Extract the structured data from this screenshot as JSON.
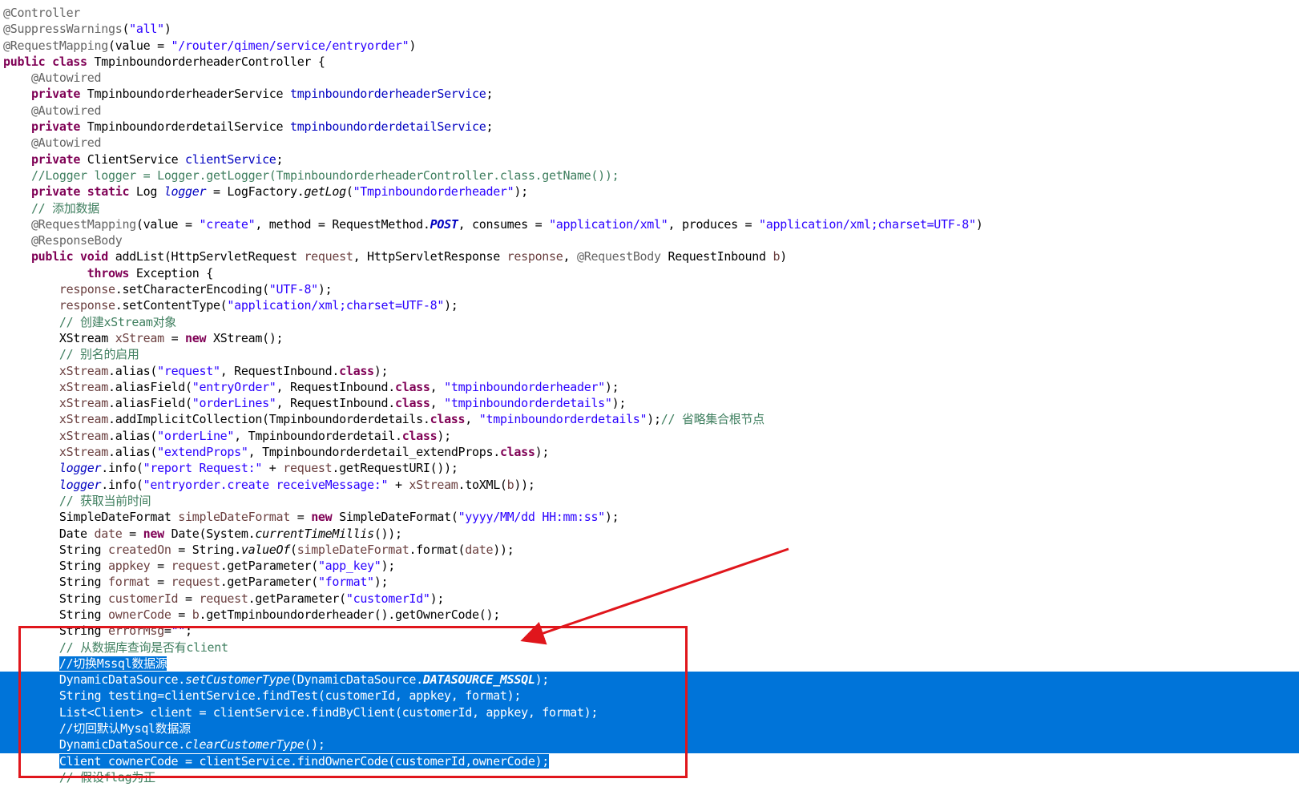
{
  "editor": {
    "lines": [
      {
        "indent": 0,
        "tokens": [
          {
            "t": "@Controller",
            "c": "ann"
          }
        ]
      },
      {
        "indent": 0,
        "tokens": [
          {
            "t": "@SuppressWarnings",
            "c": "ann"
          },
          {
            "t": "(",
            "c": "plain"
          },
          {
            "t": "\"all\"",
            "c": "str"
          },
          {
            "t": ")",
            "c": "plain"
          }
        ]
      },
      {
        "indent": 0,
        "tokens": [
          {
            "t": "@RequestMapping",
            "c": "ann"
          },
          {
            "t": "(value = ",
            "c": "plain"
          },
          {
            "t": "\"/router/qimen/service/entryorder\"",
            "c": "str"
          },
          {
            "t": ")",
            "c": "plain"
          }
        ]
      },
      {
        "indent": 0,
        "tokens": [
          {
            "t": "public class",
            "c": "kw"
          },
          {
            "t": " TmpinboundorderheaderController {",
            "c": "plain"
          }
        ]
      },
      {
        "indent": 1,
        "tokens": [
          {
            "t": "@Autowired",
            "c": "ann"
          }
        ]
      },
      {
        "indent": 1,
        "tokens": [
          {
            "t": "private",
            "c": "kw"
          },
          {
            "t": " TmpinboundorderheaderService ",
            "c": "plain"
          },
          {
            "t": "tmpinboundorderheaderService",
            "c": "fld"
          },
          {
            "t": ";",
            "c": "plain"
          }
        ]
      },
      {
        "indent": 1,
        "tokens": [
          {
            "t": "@Autowired",
            "c": "ann"
          }
        ]
      },
      {
        "indent": 1,
        "tokens": [
          {
            "t": "private",
            "c": "kw"
          },
          {
            "t": " TmpinboundorderdetailService ",
            "c": "plain"
          },
          {
            "t": "tmpinboundorderdetailService",
            "c": "fld"
          },
          {
            "t": ";",
            "c": "plain"
          }
        ]
      },
      {
        "indent": 1,
        "tokens": [
          {
            "t": "@Autowired",
            "c": "ann"
          }
        ]
      },
      {
        "indent": 1,
        "tokens": [
          {
            "t": "private",
            "c": "kw"
          },
          {
            "t": " ClientService ",
            "c": "plain"
          },
          {
            "t": "clientService",
            "c": "fld"
          },
          {
            "t": ";",
            "c": "plain"
          }
        ]
      },
      {
        "indent": 1,
        "tokens": [
          {
            "t": "//Logger logger = Logger.getLogger(TmpinboundorderheaderController.class.getName());",
            "c": "cm"
          }
        ]
      },
      {
        "indent": 1,
        "tokens": [
          {
            "t": "private static",
            "c": "kw"
          },
          {
            "t": " Log ",
            "c": "plain"
          },
          {
            "t": "logger",
            "c": "fld it"
          },
          {
            "t": " = LogFactory.",
            "c": "plain"
          },
          {
            "t": "getLog",
            "c": "plain it"
          },
          {
            "t": "(",
            "c": "plain"
          },
          {
            "t": "\"Tmpinboundorderheader\"",
            "c": "str"
          },
          {
            "t": ");",
            "c": "plain"
          }
        ]
      },
      {
        "indent": 1,
        "tokens": [
          {
            "t": "// 添加数据",
            "c": "cm"
          }
        ]
      },
      {
        "indent": 1,
        "tokens": [
          {
            "t": "@RequestMapping",
            "c": "ann"
          },
          {
            "t": "(value = ",
            "c": "plain"
          },
          {
            "t": "\"create\"",
            "c": "str"
          },
          {
            "t": ", method = RequestMethod.",
            "c": "plain"
          },
          {
            "t": "POST",
            "c": "fld it bld"
          },
          {
            "t": ", consumes = ",
            "c": "plain"
          },
          {
            "t": "\"application/xml\"",
            "c": "str"
          },
          {
            "t": ", produces = ",
            "c": "plain"
          },
          {
            "t": "\"application/xml;charset=UTF-8\"",
            "c": "str"
          },
          {
            "t": ")",
            "c": "plain"
          }
        ]
      },
      {
        "indent": 1,
        "tokens": [
          {
            "t": "@ResponseBody",
            "c": "ann"
          }
        ]
      },
      {
        "indent": 1,
        "tokens": [
          {
            "t": "public void",
            "c": "kw"
          },
          {
            "t": " addList(HttpServletRequest ",
            "c": "plain"
          },
          {
            "t": "request",
            "c": "var"
          },
          {
            "t": ", HttpServletResponse ",
            "c": "plain"
          },
          {
            "t": "response",
            "c": "var"
          },
          {
            "t": ", ",
            "c": "plain"
          },
          {
            "t": "@RequestBody",
            "c": "ann"
          },
          {
            "t": " RequestInbound ",
            "c": "plain"
          },
          {
            "t": "b",
            "c": "var"
          },
          {
            "t": ")",
            "c": "plain"
          }
        ]
      },
      {
        "indent": 3,
        "tokens": [
          {
            "t": "throws",
            "c": "kw"
          },
          {
            "t": " Exception {",
            "c": "plain"
          }
        ]
      },
      {
        "indent": 2,
        "tokens": [
          {
            "t": "response",
            "c": "var"
          },
          {
            "t": ".setCharacterEncoding(",
            "c": "plain"
          },
          {
            "t": "\"UTF-8\"",
            "c": "str"
          },
          {
            "t": ");",
            "c": "plain"
          }
        ]
      },
      {
        "indent": 2,
        "tokens": [
          {
            "t": "response",
            "c": "var"
          },
          {
            "t": ".setContentType(",
            "c": "plain"
          },
          {
            "t": "\"application/xml;charset=UTF-8\"",
            "c": "str"
          },
          {
            "t": ");",
            "c": "plain"
          }
        ]
      },
      {
        "indent": 2,
        "tokens": [
          {
            "t": "// 创建xStream对象",
            "c": "cm"
          }
        ]
      },
      {
        "indent": 2,
        "tokens": [
          {
            "t": "XStream ",
            "c": "plain"
          },
          {
            "t": "xStream",
            "c": "var"
          },
          {
            "t": " = ",
            "c": "plain"
          },
          {
            "t": "new",
            "c": "kw"
          },
          {
            "t": " XStream();",
            "c": "plain"
          }
        ]
      },
      {
        "indent": 2,
        "tokens": [
          {
            "t": "// 别名的启用",
            "c": "cm"
          }
        ]
      },
      {
        "indent": 2,
        "tokens": [
          {
            "t": "xStream",
            "c": "var"
          },
          {
            "t": ".alias(",
            "c": "plain"
          },
          {
            "t": "\"request\"",
            "c": "str"
          },
          {
            "t": ", RequestInbound.",
            "c": "plain"
          },
          {
            "t": "class",
            "c": "kw"
          },
          {
            "t": ");",
            "c": "plain"
          }
        ]
      },
      {
        "indent": 2,
        "tokens": [
          {
            "t": "xStream",
            "c": "var"
          },
          {
            "t": ".aliasField(",
            "c": "plain"
          },
          {
            "t": "\"entryOrder\"",
            "c": "str"
          },
          {
            "t": ", RequestInbound.",
            "c": "plain"
          },
          {
            "t": "class",
            "c": "kw"
          },
          {
            "t": ", ",
            "c": "plain"
          },
          {
            "t": "\"tmpinboundorderheader\"",
            "c": "str"
          },
          {
            "t": ");",
            "c": "plain"
          }
        ]
      },
      {
        "indent": 2,
        "tokens": [
          {
            "t": "xStream",
            "c": "var"
          },
          {
            "t": ".aliasField(",
            "c": "plain"
          },
          {
            "t": "\"orderLines\"",
            "c": "str"
          },
          {
            "t": ", RequestInbound.",
            "c": "plain"
          },
          {
            "t": "class",
            "c": "kw"
          },
          {
            "t": ", ",
            "c": "plain"
          },
          {
            "t": "\"tmpinboundorderdetails\"",
            "c": "str"
          },
          {
            "t": ");",
            "c": "plain"
          }
        ]
      },
      {
        "indent": 2,
        "tokens": [
          {
            "t": "xStream",
            "c": "var"
          },
          {
            "t": ".addImplicitCollection(Tmpinboundorderdetails.",
            "c": "plain"
          },
          {
            "t": "class",
            "c": "kw"
          },
          {
            "t": ", ",
            "c": "plain"
          },
          {
            "t": "\"tmpinboundorderdetails\"",
            "c": "str"
          },
          {
            "t": ");",
            "c": "plain"
          },
          {
            "t": "// 省略集合根节点",
            "c": "cm"
          }
        ]
      },
      {
        "indent": 2,
        "tokens": [
          {
            "t": "xStream",
            "c": "var"
          },
          {
            "t": ".alias(",
            "c": "plain"
          },
          {
            "t": "\"orderLine\"",
            "c": "str"
          },
          {
            "t": ", Tmpinboundorderdetail.",
            "c": "plain"
          },
          {
            "t": "class",
            "c": "kw"
          },
          {
            "t": ");",
            "c": "plain"
          }
        ]
      },
      {
        "indent": 2,
        "tokens": [
          {
            "t": "xStream",
            "c": "var"
          },
          {
            "t": ".alias(",
            "c": "plain"
          },
          {
            "t": "\"extendProps\"",
            "c": "str"
          },
          {
            "t": ", Tmpinboundorderdetail_extendProps.",
            "c": "plain"
          },
          {
            "t": "class",
            "c": "kw"
          },
          {
            "t": ");",
            "c": "plain"
          }
        ]
      },
      {
        "indent": 2,
        "tokens": [
          {
            "t": "logger",
            "c": "fld it"
          },
          {
            "t": ".info(",
            "c": "plain"
          },
          {
            "t": "\"report Request:\"",
            "c": "str"
          },
          {
            "t": " + ",
            "c": "plain"
          },
          {
            "t": "request",
            "c": "var"
          },
          {
            "t": ".getRequestURI());",
            "c": "plain"
          }
        ]
      },
      {
        "indent": 2,
        "tokens": [
          {
            "t": "logger",
            "c": "fld it"
          },
          {
            "t": ".info(",
            "c": "plain"
          },
          {
            "t": "\"entryorder.create receiveMessage:\"",
            "c": "str"
          },
          {
            "t": " + ",
            "c": "plain"
          },
          {
            "t": "xStream",
            "c": "var"
          },
          {
            "t": ".toXML(",
            "c": "plain"
          },
          {
            "t": "b",
            "c": "var"
          },
          {
            "t": "));",
            "c": "plain"
          }
        ]
      },
      {
        "indent": 2,
        "tokens": [
          {
            "t": "// 获取当前时间",
            "c": "cm"
          }
        ]
      },
      {
        "indent": 2,
        "tokens": [
          {
            "t": "SimpleDateFormat ",
            "c": "plain"
          },
          {
            "t": "simpleDateFormat",
            "c": "var"
          },
          {
            "t": " = ",
            "c": "plain"
          },
          {
            "t": "new",
            "c": "kw"
          },
          {
            "t": " SimpleDateFormat(",
            "c": "plain"
          },
          {
            "t": "\"yyyy/MM/dd HH:mm:ss\"",
            "c": "str"
          },
          {
            "t": ");",
            "c": "plain"
          }
        ]
      },
      {
        "indent": 2,
        "tokens": [
          {
            "t": "Date ",
            "c": "plain"
          },
          {
            "t": "date",
            "c": "var"
          },
          {
            "t": " = ",
            "c": "plain"
          },
          {
            "t": "new",
            "c": "kw"
          },
          {
            "t": " Date(System.",
            "c": "plain"
          },
          {
            "t": "currentTimeMillis",
            "c": "plain it"
          },
          {
            "t": "());",
            "c": "plain"
          }
        ]
      },
      {
        "indent": 2,
        "tokens": [
          {
            "t": "String ",
            "c": "plain"
          },
          {
            "t": "createdOn",
            "c": "var"
          },
          {
            "t": " = String.",
            "c": "plain"
          },
          {
            "t": "valueOf",
            "c": "plain it"
          },
          {
            "t": "(",
            "c": "plain"
          },
          {
            "t": "simpleDateFormat",
            "c": "var"
          },
          {
            "t": ".format(",
            "c": "plain"
          },
          {
            "t": "date",
            "c": "var"
          },
          {
            "t": "));",
            "c": "plain"
          }
        ]
      },
      {
        "indent": 2,
        "tokens": [
          {
            "t": "String ",
            "c": "plain"
          },
          {
            "t": "appkey",
            "c": "var"
          },
          {
            "t": " = ",
            "c": "plain"
          },
          {
            "t": "request",
            "c": "var"
          },
          {
            "t": ".getParameter(",
            "c": "plain"
          },
          {
            "t": "\"app_key\"",
            "c": "str"
          },
          {
            "t": ");",
            "c": "plain"
          }
        ]
      },
      {
        "indent": 2,
        "tokens": [
          {
            "t": "String ",
            "c": "plain"
          },
          {
            "t": "format",
            "c": "var"
          },
          {
            "t": " = ",
            "c": "plain"
          },
          {
            "t": "request",
            "c": "var"
          },
          {
            "t": ".getParameter(",
            "c": "plain"
          },
          {
            "t": "\"format\"",
            "c": "str"
          },
          {
            "t": ");",
            "c": "plain"
          }
        ]
      },
      {
        "indent": 2,
        "tokens": [
          {
            "t": "String ",
            "c": "plain"
          },
          {
            "t": "customerId",
            "c": "var"
          },
          {
            "t": " = ",
            "c": "plain"
          },
          {
            "t": "request",
            "c": "var"
          },
          {
            "t": ".getParameter(",
            "c": "plain"
          },
          {
            "t": "\"customerId\"",
            "c": "str"
          },
          {
            "t": ");",
            "c": "plain"
          }
        ]
      },
      {
        "indent": 2,
        "tokens": [
          {
            "t": "String ",
            "c": "plain"
          },
          {
            "t": "ownerCode",
            "c": "var"
          },
          {
            "t": " = ",
            "c": "plain"
          },
          {
            "t": "b",
            "c": "var"
          },
          {
            "t": ".getTmpinboundorderheader().getOwnerCode();",
            "c": "plain"
          }
        ]
      },
      {
        "indent": 2,
        "tokens": [
          {
            "t": "String ",
            "c": "plain"
          },
          {
            "t": "errorMsg",
            "c": "var"
          },
          {
            "t": "=",
            "c": "plain"
          },
          {
            "t": "\"\"",
            "c": "str"
          },
          {
            "t": ";",
            "c": "plain"
          }
        ]
      },
      {
        "indent": 2,
        "tokens": [
          {
            "t": "// 从数据库查询是否有client",
            "c": "cm"
          }
        ]
      },
      {
        "indent": 2,
        "sel": "part",
        "tokens": [
          {
            "t": "//切换Mssql数据源",
            "c": "cm"
          }
        ]
      },
      {
        "indent": 2,
        "sel": "full",
        "tokens": [
          {
            "t": "DynamicDataSource.",
            "c": "plain"
          },
          {
            "t": "setCustomerType",
            "c": "plain it"
          },
          {
            "t": "(DynamicDataSource.",
            "c": "plain"
          },
          {
            "t": "DATASOURCE_MSSQL",
            "c": "fld it bld"
          },
          {
            "t": ");",
            "c": "plain"
          }
        ]
      },
      {
        "indent": 2,
        "sel": "full",
        "tokens": [
          {
            "t": "String testing=clientService.findTest(customerId, appkey, format);",
            "c": "plain"
          }
        ]
      },
      {
        "indent": 2,
        "sel": "full",
        "tokens": [
          {
            "t": "List<Client> client = clientService.findByClient(customerId, appkey, format);",
            "c": "plain"
          }
        ]
      },
      {
        "indent": 2,
        "sel": "full",
        "tokens": [
          {
            "t": "//切回默认Mysql数据源",
            "c": "cm"
          }
        ]
      },
      {
        "indent": 2,
        "sel": "full",
        "tokens": [
          {
            "t": "DynamicDataSource.",
            "c": "plain"
          },
          {
            "t": "clearCustomerType",
            "c": "plain it"
          },
          {
            "t": "();",
            "c": "plain"
          }
        ]
      },
      {
        "indent": 2,
        "sel": "part",
        "tokens": [
          {
            "t": "Client cownerCode = clientService.findOwnerCode(customerId,ownerCode);",
            "c": "plain"
          }
        ]
      },
      {
        "indent": 2,
        "tokens": [
          {
            "t": "// 假设flag为正",
            "c": "cm"
          }
        ]
      }
    ]
  },
  "colors": {
    "selection": "#0074d9",
    "annotation_box": "#e0161c",
    "keyword": "#7f0055",
    "string": "#2a00ff",
    "comment": "#3f7f5f",
    "field": "#0000c0",
    "local_variable": "#6a3e3e"
  }
}
